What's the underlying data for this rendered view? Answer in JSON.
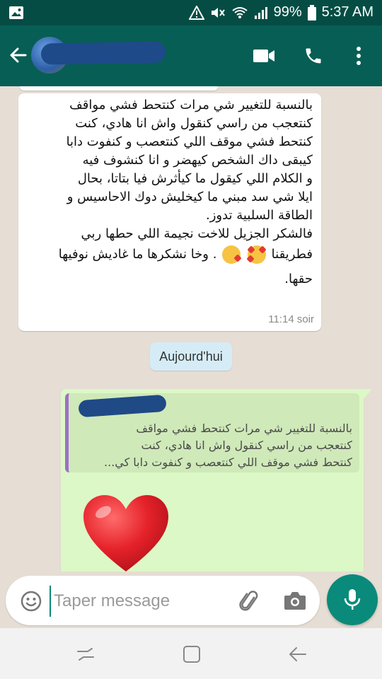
{
  "status_bar": {
    "battery": "99%",
    "time": "5:37 AM"
  },
  "chat": {
    "incoming": {
      "lines": [
        "بالنسبة للتغيير شي مرات كنتحط فشي مواقف",
        "كنتعجب من راسي كنقول واش انا هادي، كنت",
        "كنتحط فشي موقف اللي كنتعصب و كنفوت دابا",
        "كيبقى داك الشخص كيهضر و انا كنشوف فيه",
        "و الكلام اللي كيقول ما كيأثرش فيا بتاتا، بحال",
        "ايلا شي سد مبني ما كيخليش دوك الاحاسيس و",
        "الطاقة السلبية تدوز.",
        "فالشكر الجزيل للاخت نجيمة اللي حطها ربي",
        "فطريقنا",
        ". وخا نشكرها ما غاديش نوفيها",
        "حقها."
      ],
      "time": "11:14 soir"
    },
    "date_separator": "Aujourd'hui",
    "outgoing": {
      "quote_lines": [
        "بالنسبة للتغيير شي مرات كنتحط فشي مواقف",
        "كنتعجب من راسي كنقول واش انا هادي، كنت",
        "كنتحط فشي موقف اللي كنتعصب و كنفوت دابا كي..."
      ]
    }
  },
  "input": {
    "placeholder": "Taper message"
  },
  "icons": {
    "back": "arrow-left-icon",
    "video": "video-camera-icon",
    "call": "phone-icon",
    "menu": "more-vert-icon",
    "emoji": "emoji-icon",
    "attach": "paperclip-icon",
    "camera": "camera-icon",
    "mic": "microphone-icon"
  },
  "colors": {
    "header": "#075e54",
    "status_bar": "#054d44",
    "outgoing_bubble": "#dcf8c6",
    "accent": "#0a8a7a"
  }
}
